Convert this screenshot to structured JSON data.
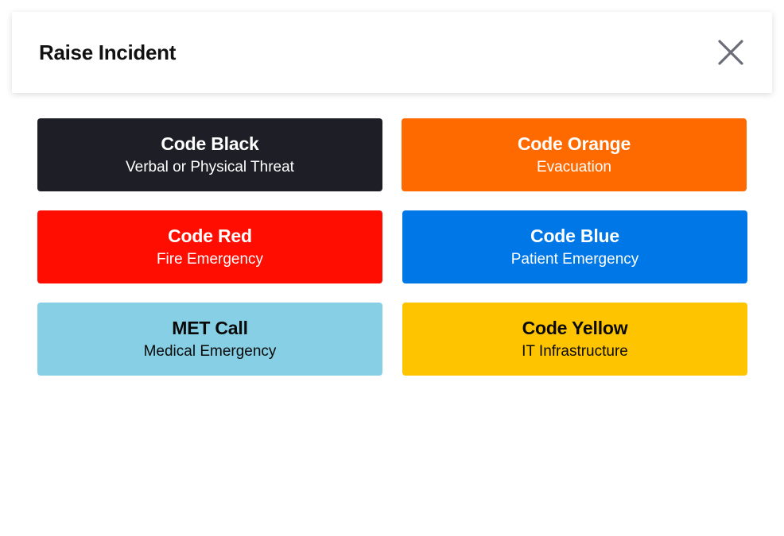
{
  "header": {
    "title": "Raise Incident",
    "close_icon": "close-icon"
  },
  "incidents": [
    {
      "name": "Code Black",
      "description": "Verbal or Physical Threat",
      "bg": "#1e1f26",
      "fg": "#ffffff"
    },
    {
      "name": "Code Orange",
      "description": "Evacuation",
      "bg": "#ff6a00",
      "fg": "#ffffff"
    },
    {
      "name": "Code Red",
      "description": "Fire Emergency",
      "bg": "#ff0d00",
      "fg": "#ffffff"
    },
    {
      "name": "Code Blue",
      "description": "Patient Emergency",
      "bg": "#0077e6",
      "fg": "#ffffff"
    },
    {
      "name": "MET Call",
      "description": "Medical Emergency",
      "bg": "#86cfe4",
      "fg": "#0a0a0a"
    },
    {
      "name": "Code Yellow",
      "description": "IT Infrastructure",
      "bg": "#ffc400",
      "fg": "#0a0a0a"
    }
  ]
}
